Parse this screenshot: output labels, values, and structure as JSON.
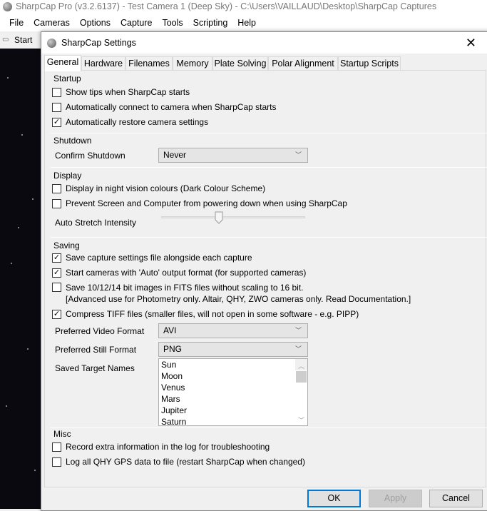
{
  "window": {
    "title": "SharpCap Pro (v3.2.6137) - Test Camera 1 (Deep Sky) - C:\\Users\\VAILLAUD\\Desktop\\SharpCap Captures"
  },
  "menu": [
    "File",
    "Cameras",
    "Options",
    "Capture",
    "Tools",
    "Scripting",
    "Help"
  ],
  "toolbar": {
    "start": "Start C"
  },
  "dialog": {
    "title": "SharpCap Settings",
    "close": "✕",
    "tabs": [
      "General",
      "Hardware",
      "Filenames",
      "Memory",
      "Plate Solving",
      "Polar Alignment",
      "Startup Scripts"
    ],
    "startup": {
      "header": "Startup",
      "items": [
        {
          "label": "Show tips when SharpCap starts",
          "checked": false
        },
        {
          "label": "Automatically connect to camera when SharpCap starts",
          "checked": false
        },
        {
          "label": "Automatically restore camera settings",
          "checked": true
        }
      ]
    },
    "shutdown": {
      "header": "Shutdown",
      "confirm_label": "Confirm Shutdown",
      "confirm_value": "Never"
    },
    "display": {
      "header": "Display",
      "items": [
        {
          "label": "Display in night vision colours (Dark Colour Scheme)",
          "checked": false
        },
        {
          "label": "Prevent Screen and Computer from powering down when using SharpCap",
          "checked": false
        }
      ],
      "stretch_label": "Auto Stretch Intensity",
      "stretch_value": 0.4
    },
    "saving": {
      "header": "Saving",
      "items": [
        {
          "label": "Save capture settings file alongside each capture",
          "checked": true
        },
        {
          "label": "Start cameras with 'Auto' output format (for supported cameras)",
          "checked": true
        },
        {
          "label": "Save 10/12/14 bit images in FITS files without scaling to 16 bit.",
          "label2": "[Advanced use for Photometry only. Altair, QHY, ZWO cameras only. Read Documentation.]",
          "checked": false
        },
        {
          "label": "Compress TIFF files (smaller files, will not open in some software - e.g. PIPP)",
          "checked": true
        }
      ],
      "video_label": "Preferred Video Format",
      "video_value": "AVI",
      "still_label": "Preferred Still Format",
      "still_value": "PNG",
      "targets_label": "Saved Target Names",
      "targets": [
        "Sun",
        "Moon",
        "Venus",
        "Mars",
        "Jupiter",
        "Saturn"
      ]
    },
    "misc": {
      "header": "Misc",
      "items": [
        {
          "label": "Record extra information in the log for troubleshooting",
          "checked": false
        },
        {
          "label": "Log all QHY GPS data to file (restart SharpCap when changed)",
          "checked": false
        }
      ]
    },
    "buttons": {
      "ok": "OK",
      "apply": "Apply",
      "cancel": "Cancel"
    }
  }
}
